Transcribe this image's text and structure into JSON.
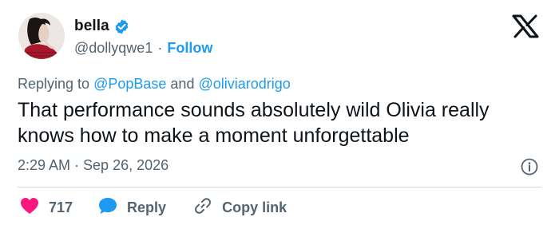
{
  "user": {
    "display_name": "bella",
    "handle": "@dollyqwe1",
    "separator": "·",
    "follow_label": "Follow"
  },
  "reply_context": {
    "prefix": "Replying to",
    "mention_1": "@PopBase",
    "conjunction": "and",
    "mention_2": "@oliviarodrigo"
  },
  "tweet": {
    "text": "That performance sounds absolutely wild Olivia really knows how to make a moment unforgettable",
    "timestamp": "2:29 AM · Sep 26, 2026"
  },
  "actions": {
    "like_count": "717",
    "reply_label": "Reply",
    "copy_label": "Copy link"
  },
  "colors": {
    "accent": "#1d9bf0",
    "like": "#f91880",
    "muted": "#536471",
    "text": "#0f1419"
  },
  "icons": [
    "verified-badge-icon",
    "x-logo-icon",
    "info-icon",
    "heart-icon",
    "speech-bubble-icon",
    "link-icon"
  ]
}
